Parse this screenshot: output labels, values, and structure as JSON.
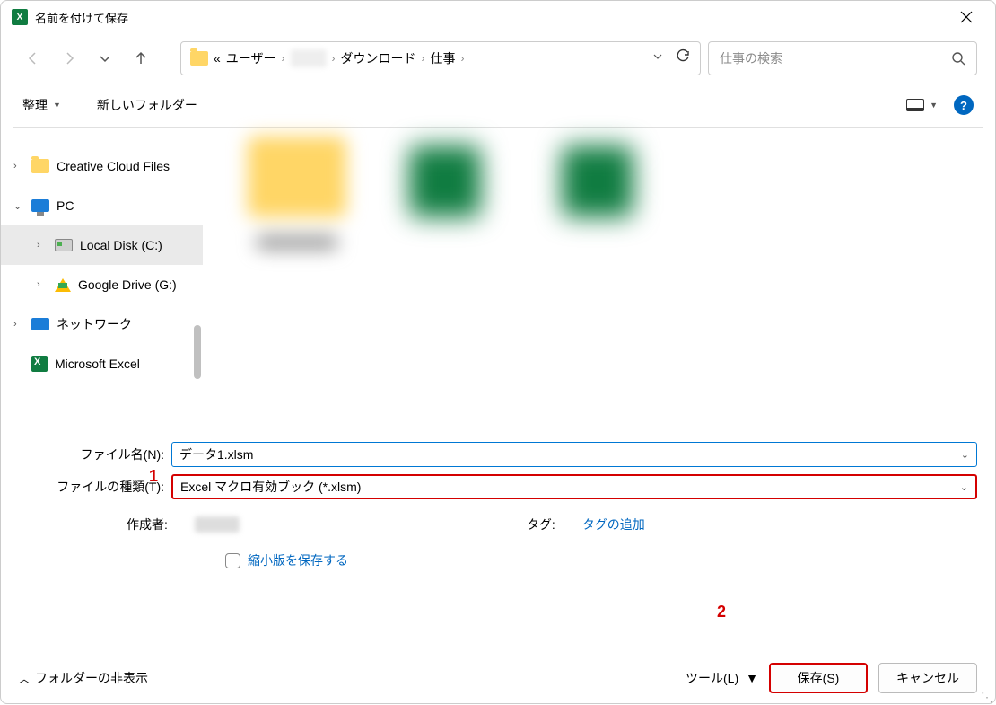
{
  "window": {
    "title": "名前を付けて保存"
  },
  "breadcrumb": {
    "prefix": "«",
    "parts": [
      "ユーザー",
      "ダウンロード",
      "仕事"
    ],
    "sep": "›"
  },
  "search": {
    "placeholder": "仕事の検索"
  },
  "toolbar": {
    "organize": "整理",
    "new_folder": "新しいフォルダー"
  },
  "sidebar": {
    "items": [
      {
        "label": "Creative Cloud Files"
      },
      {
        "label": "PC"
      },
      {
        "label": "Local Disk (C:)"
      },
      {
        "label": "Google Drive (G:)"
      },
      {
        "label": "ネットワーク"
      },
      {
        "label": "Microsoft Excel"
      }
    ]
  },
  "form": {
    "filename_label": "ファイル名(N):",
    "filename_value": "データ1.xlsm",
    "filetype_label": "ファイルの種類(T):",
    "filetype_value": "Excel マクロ有効ブック (*.xlsm)",
    "author_label": "作成者:",
    "tag_label": "タグ:",
    "tag_add": "タグの追加",
    "thumbnail_label": "縮小版を保存する"
  },
  "footer": {
    "hide_folders": "フォルダーの非表示",
    "tools": "ツール(L)",
    "save": "保存(S)",
    "cancel": "キャンセル"
  },
  "annotations": {
    "one": "1",
    "two": "2"
  }
}
